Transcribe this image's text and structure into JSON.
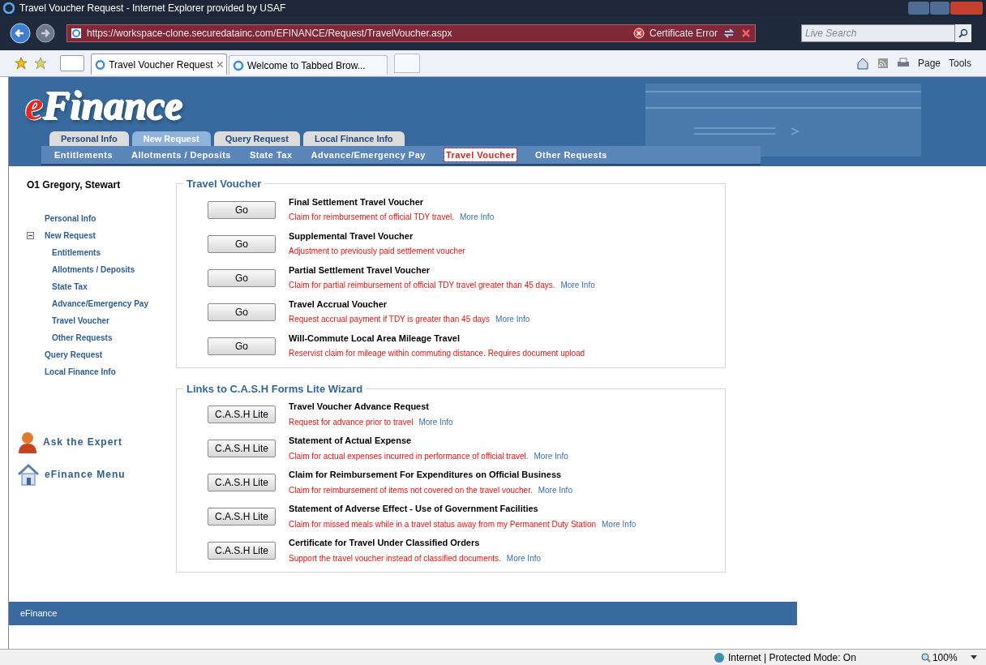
{
  "window": {
    "title": "Travel Voucher Request - Internet Explorer provided by USAF"
  },
  "browser": {
    "address": "https://workspace-clone.securedatainc.com/EFINANCE/Request/TravelVoucher.aspx",
    "certificate": "Certificate Error",
    "search_placeholder": "Live Search",
    "tabs": [
      {
        "label": "Travel Voucher Request",
        "selected": true
      },
      {
        "label": "Welcome to Tabbed Brow...",
        "selected": false
      }
    ],
    "commands": [
      "Page",
      "Tools"
    ]
  },
  "header": {
    "logo": "eFinance",
    "tabs": [
      {
        "label": "Personal Info",
        "selected": false
      },
      {
        "label": "New Request",
        "selected": true
      },
      {
        "label": "Query Request",
        "selected": false
      },
      {
        "label": "Local Finance Info",
        "selected": false
      }
    ],
    "sub_nav": [
      {
        "label": "Entitlements",
        "selected": false
      },
      {
        "label": "Allotments / Deposits",
        "selected": false
      },
      {
        "label": "State Tax",
        "selected": false
      },
      {
        "label": "Advance/Emergency Pay",
        "selected": false
      },
      {
        "label": "Travel Voucher",
        "selected": true
      },
      {
        "label": "Other Requests",
        "selected": false
      }
    ]
  },
  "sidebar": {
    "user": "O1 Gregory, Stewart",
    "items": [
      {
        "label": "Personal Info"
      },
      {
        "label": "New Request",
        "expanded": true,
        "children": [
          {
            "label": "Entitlements"
          },
          {
            "label": "Allotments / Deposits"
          },
          {
            "label": "State Tax"
          },
          {
            "label": "Advance/Emergency Pay"
          },
          {
            "label": "Travel Voucher"
          },
          {
            "label": "Other Requests"
          }
        ]
      },
      {
        "label": "Query Request"
      },
      {
        "label": "Local Finance Info"
      }
    ],
    "links": [
      {
        "label": "Ask the Expert",
        "kind": "expert"
      },
      {
        "label": "eFinance Menu",
        "kind": "home"
      }
    ]
  },
  "sections": [
    {
      "title": "Travel Voucher",
      "items": [
        {
          "button": "Go",
          "title": "Final Settlement Travel Voucher",
          "description": "Claim for reimbursement of official TDY travel.",
          "more_info": "More Info"
        },
        {
          "button": "Go",
          "title": "Supplemental Travel Voucher",
          "description": "Adjustment to previously paid settlement voucher"
        },
        {
          "button": "Go",
          "title": "Partial Settlement Travel Voucher",
          "description": "Claim for partial reimbursement of official TDY travel greater than 45 days.",
          "more_info": "More Info"
        },
        {
          "button": "Go",
          "title": "Travel Accrual Voucher",
          "description": "Request accrual payment if TDY is greater than 45 days",
          "more_info": "More Info"
        },
        {
          "button": "Go",
          "title": "Will-Commute Local Area Mileage Travel",
          "description": "Reservist claim for mileage within commuting distance. Requires document upload"
        }
      ]
    },
    {
      "title": "Links to C.A.S.H Forms Lite Wizard",
      "items": [
        {
          "button": "C.A.S.H Lite",
          "title": "Travel Voucher Advance Request",
          "description": "Request for advance prior to travel",
          "more_info": "More Info"
        },
        {
          "button": "C.A.S.H Lite",
          "title": "Statement of Actual Expense",
          "description": "Claim for actual expenses incurred in performance of official travel.",
          "more_info": "More Info"
        },
        {
          "button": "C.A.S.H Lite",
          "title": "Claim for Reimbursement For Expenditures on Official Business",
          "description": "Claim for reimbursement of items not covered on the travel voucher.",
          "more_info": "More Info"
        },
        {
          "button": "C.A.S.H Lite",
          "title": "Statement of Adverse Effect - Use of Government Facilities",
          "description": "Claim for missed meals while in a travel status away from my Permanent Duty Station",
          "more_info": "More Info"
        },
        {
          "button": "C.A.S.H Lite",
          "title": "Certificate for Travel Under Classified Orders",
          "description": "Support the travel voucher instead of classified documents.",
          "more_info": "More Info"
        }
      ]
    }
  ],
  "footer": "eFinance",
  "status_bar": {
    "zone": "Internet | Protected Mode: On",
    "zoom": "100%"
  }
}
